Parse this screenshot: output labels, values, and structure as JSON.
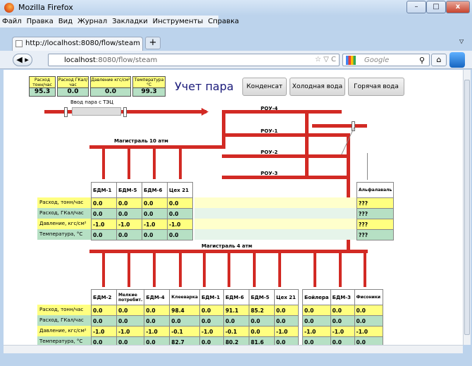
{
  "window": {
    "title": "Mozilla Firefox",
    "min": "–",
    "max": "□",
    "close": "x"
  },
  "menu": [
    "Файл",
    "Правка",
    "Вид",
    "Журнал",
    "Закладки",
    "Инструменты",
    "Справка"
  ],
  "tab": {
    "title": "http://localhost:8080/flow/steam",
    "new_tab": "+"
  },
  "address": {
    "host": "localhost",
    "path": ":8080/flow/steam",
    "icons": "☆ ▽ C"
  },
  "search": {
    "placeholder": "Google"
  },
  "kpis": [
    {
      "label": "Расход тонн/час",
      "value": "95.3"
    },
    {
      "label": "Расход ГКал/час",
      "value": "0.0"
    },
    {
      "label": "Давление кгс/см²",
      "value": "0.0"
    },
    {
      "label": "Температура °C",
      "value": "99.3"
    }
  ],
  "page_title": "Учет пара",
  "nav_buttons": [
    "Конденсат",
    "Холодная вода",
    "Горячая вода"
  ],
  "labels": {
    "inlet": "Ввод пара с ТЭЦ",
    "main10": "Магистраль 10 атм",
    "main4": "Магистраль 4 атм",
    "rou4": "РОУ-4",
    "rou1": "РОУ-1",
    "rou2": "РОУ-2",
    "rou3": "РОУ-3"
  },
  "row_labels": [
    "Расход, тонн/час",
    "Расход, ГКал/час",
    "Давление, кгс/см²",
    "Температура, °C"
  ],
  "upper_table": {
    "headers": [
      "БДМ-1",
      "БДМ-5",
      "БДМ-6",
      "Цех 21"
    ],
    "rows": [
      [
        "0.0",
        "0.0",
        "0.0",
        "0.0"
      ],
      [
        "0.0",
        "0.0",
        "0.0",
        "0.0"
      ],
      [
        "-1.0",
        "-1.0",
        "-1.0",
        "-1.0"
      ],
      [
        "0.0",
        "0.0",
        "0.0",
        "0.0"
      ]
    ]
  },
  "alfa_table": {
    "header": "Альфалаваль",
    "rows": [
      "???",
      "???",
      "???",
      "???"
    ]
  },
  "lower_table_a": {
    "headers": [
      "БДМ-2",
      "Мелкие потребит.",
      "БДМ-4",
      "Клееварка",
      "БДМ-1",
      "БДМ-6",
      "БДМ-5",
      "Цех 21"
    ],
    "rows": [
      [
        "0.0",
        "0.0",
        "0.0",
        "98.4",
        "0.0",
        "91.1",
        "85.2",
        "0.0"
      ],
      [
        "0.0",
        "0.0",
        "0.0",
        "0.0",
        "0.0",
        "0.0",
        "0.0",
        "0.0"
      ],
      [
        "-1.0",
        "-1.0",
        "-1.0",
        "-0.1",
        "-1.0",
        "-0.1",
        "0.0",
        "-1.0"
      ],
      [
        "0.0",
        "0.0",
        "0.0",
        "82.7",
        "0.0",
        "80.2",
        "81.6",
        "0.0"
      ]
    ]
  },
  "lower_table_b": {
    "headers": [
      "Бойлера",
      "БДМ-3",
      "Фисоники"
    ],
    "rows": [
      [
        "0.0",
        "0.0",
        "0.0"
      ],
      [
        "0.0",
        "0.0",
        "0.0"
      ],
      [
        "-1.0",
        "-1.0",
        "-1.0"
      ],
      [
        "0.0",
        "0.0",
        "0.0"
      ]
    ]
  },
  "colors": {
    "pipe": "#d22a24",
    "yellow": "#ffff80",
    "green": "#b6e0c4",
    "title": "#1a1a7a"
  }
}
